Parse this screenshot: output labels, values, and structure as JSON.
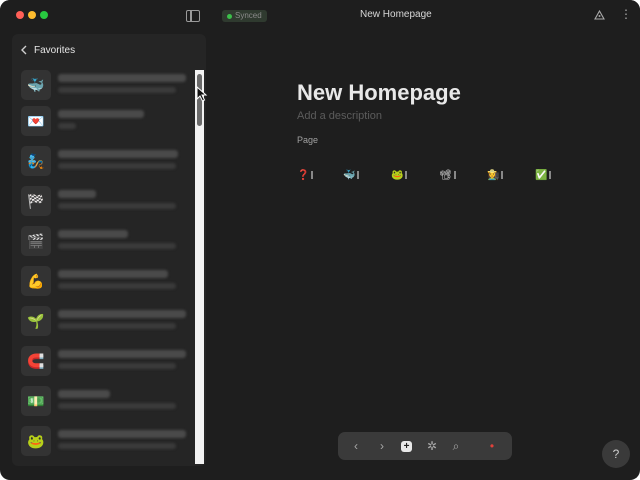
{
  "titlebar": {
    "status": "Synced",
    "page_title": "New Homepage"
  },
  "sidebar": {
    "title": "Favorites",
    "items": [
      {
        "emoji": "🐳"
      },
      {
        "emoji": "💌"
      },
      {
        "emoji": "🧞"
      },
      {
        "emoji": "🏁"
      },
      {
        "emoji": "🎬"
      },
      {
        "emoji": "💪"
      },
      {
        "emoji": "🌱"
      },
      {
        "emoji": "🧲"
      },
      {
        "emoji": "💵"
      },
      {
        "emoji": "🐸"
      }
    ]
  },
  "document": {
    "title": "New Homepage",
    "description_placeholder": "Add a description",
    "section_label": "Page",
    "favorites": [
      {
        "emoji": "❓"
      },
      {
        "emoji": "🐳"
      },
      {
        "emoji": "🐸"
      },
      {
        "emoji": "📽"
      },
      {
        "emoji": "👩‍🌾"
      },
      {
        "emoji": "✅"
      }
    ]
  },
  "toolbar": {
    "back": "‹",
    "forward": "›",
    "new": "+",
    "graph": "✲",
    "search": "⌕",
    "ai": "•"
  },
  "help": {
    "label": "?"
  },
  "colors": {
    "background": "#1e1e1e",
    "panel": "#252525",
    "synced_dot": "#3cbf4a",
    "accent_red": "#e0413a"
  }
}
